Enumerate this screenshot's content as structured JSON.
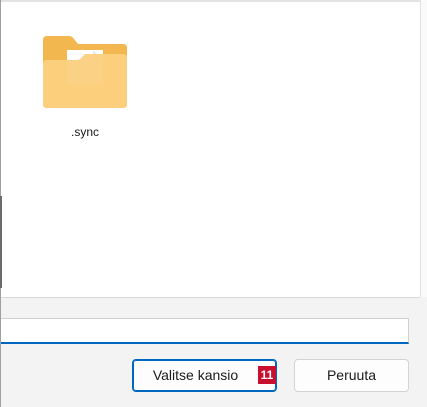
{
  "files": [
    {
      "name": ".sync",
      "type": "folder",
      "icon": "folder-icon"
    }
  ],
  "filename_input": {
    "value": ""
  },
  "buttons": {
    "select_folder_label": "Valitse kansio",
    "cancel_label": "Peruuta"
  },
  "marker": {
    "label": "11",
    "color": "#c8102e"
  },
  "colors": {
    "accent": "#0067c0",
    "folder_back": "#f5c26b",
    "folder_front": "#fbd88f"
  }
}
